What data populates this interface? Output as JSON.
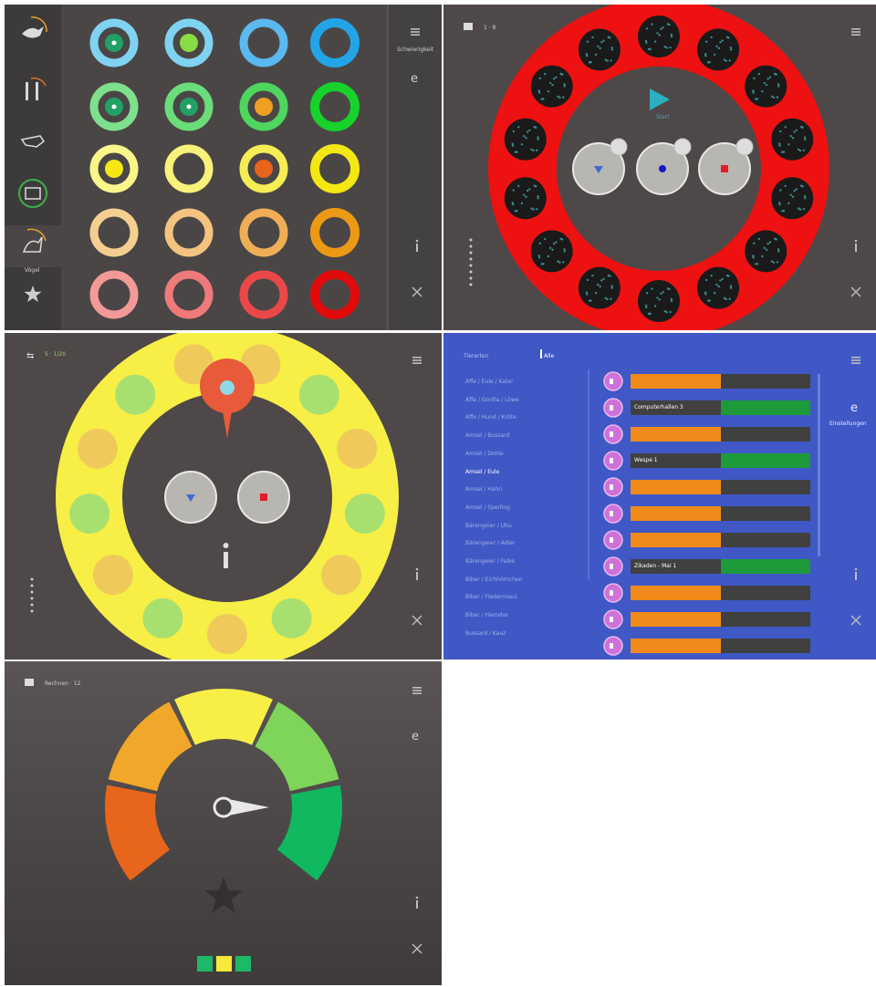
{
  "colors": {
    "dark_bg": "#4a4646",
    "sidebar_bg": "#3d3a3a",
    "red_ring": "#ee1111",
    "yellow_ring": "#f7ef45",
    "blue_bg": "#3f58c6",
    "orange_bar": "#f08a1a",
    "green_bar": "#1d9a3a",
    "speaker_purple": "#cf72d8"
  },
  "panel1": {
    "sidebar_items": [
      "bird-icon",
      "utensils-icon",
      "whistle-icon",
      "drum-icon",
      "bird-outline-icon",
      "star-icon"
    ],
    "active_label": "Vögel",
    "right_label": "Schwierigkeit",
    "ring_rows": [
      [
        "#7fd3f0",
        "#7fd3f0",
        "#5ab9ee",
        "#22a4e6"
      ],
      [
        "#7ee08c",
        "#6bdc7a",
        "#4ed65e",
        "#16d22a"
      ],
      [
        "#fbf68a",
        "#f8f27a",
        "#f6ed55",
        "#f4e714"
      ],
      [
        "#f5cf90",
        "#f3c37f",
        "#efae56",
        "#ec9916"
      ],
      [
        "#f29a98",
        "#ef7a7a",
        "#ea4848",
        "#e10b0b"
      ]
    ],
    "ring_centers": [
      [
        "#22a066",
        "#88dd44",
        "",
        ""
      ],
      [
        "#22a066",
        "#22a066",
        "#f0a020",
        ""
      ],
      [
        "#f4e714",
        "",
        "#e8631b",
        ""
      ],
      [
        "",
        "",
        "",
        ""
      ],
      [
        "",
        "",
        "",
        ""
      ]
    ]
  },
  "panel2": {
    "header_text": "1 · 8",
    "play_label": "Start"
  },
  "panel3": {
    "header_text": "5 · 1/20"
  },
  "panel4": {
    "breadcrumb_back": "Tierarten",
    "breadcrumb_current": "Alle",
    "right_label": "Einstellungen",
    "list_items": [
      "Affe / Eule / Kater",
      "Affe / Gorilla / Löwe",
      "Affe / Hund / Kröte",
      "Amsel / Bussard",
      "Amsel / Dohle",
      "Amsel / Eule",
      "Amsel / Hahn",
      "Amsel / Sperling",
      "Bärengeier / Uhu",
      "Bärengeier / Adler",
      "Bärengeier / Falke",
      "Biber / Eichhörnchen",
      "Biber / Fledermaus",
      "Biber / Hamster",
      "Bussard / Kauz"
    ],
    "active_index": 5,
    "bars": [
      {
        "label": "",
        "fill": 0.5,
        "color": "orange"
      },
      {
        "label": "Computerhallen 3",
        "fill": 0.5,
        "color": "green"
      },
      {
        "label": "",
        "fill": 0.5,
        "color": "orange"
      },
      {
        "label": "Wespe 1",
        "fill": 0.5,
        "color": "green"
      },
      {
        "label": "",
        "fill": 0.5,
        "color": "orange"
      },
      {
        "label": "",
        "fill": 0.5,
        "color": "orange"
      },
      {
        "label": "",
        "fill": 0.5,
        "color": "orange"
      },
      {
        "label": "Zikaden - Mai 1",
        "fill": 0.5,
        "color": "green"
      },
      {
        "label": "",
        "fill": 0.5,
        "color": "orange"
      },
      {
        "label": "",
        "fill": 0.5,
        "color": "orange"
      },
      {
        "label": "",
        "fill": 0.5,
        "color": "orange"
      }
    ]
  },
  "panel5": {
    "header_text": "Rechnen · 12",
    "gauge_segments": [
      "#e8661b",
      "#f0a72a",
      "#f7ef45",
      "#7fd45a",
      "#10b860"
    ],
    "squares": [
      "#1db868",
      "#f6e93a",
      "#1db868"
    ]
  }
}
